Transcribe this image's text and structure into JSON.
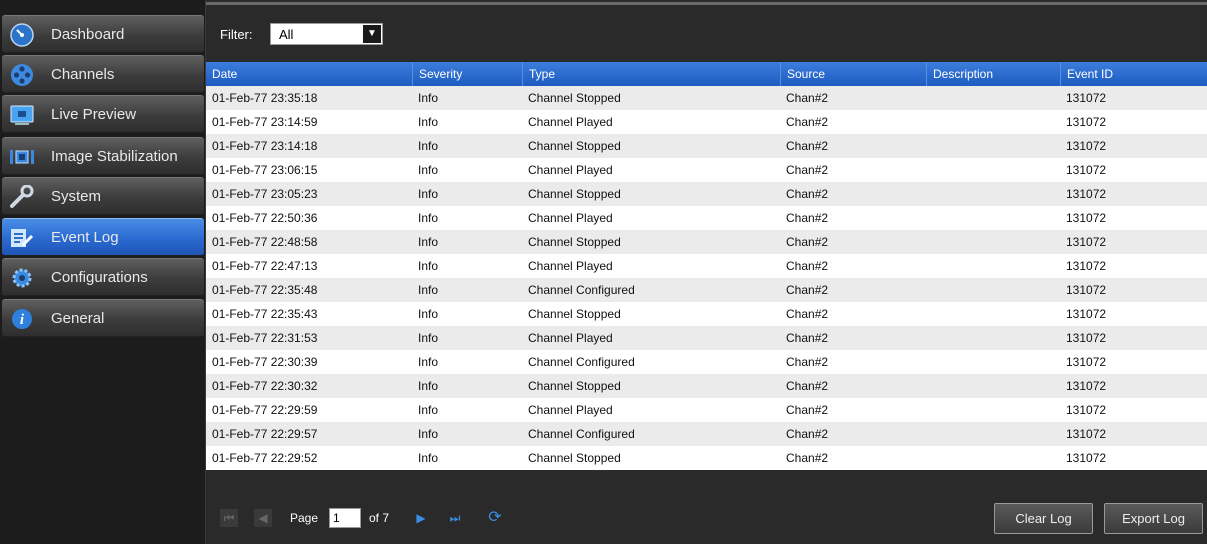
{
  "sidebar": {
    "items": [
      {
        "label": "Dashboard",
        "icon": "dashboard-gauge-icon"
      },
      {
        "label": "Channels",
        "icon": "film-reel-icon"
      },
      {
        "label": "Live Preview",
        "icon": "monitor-icon"
      },
      {
        "label": "Image Stabilization",
        "icon": "stabilization-icon"
      },
      {
        "label": "System",
        "icon": "wrench-icon"
      },
      {
        "label": "Event Log",
        "icon": "edit-log-icon"
      },
      {
        "label": "Configurations",
        "icon": "gear-icon"
      },
      {
        "label": "General",
        "icon": "info-icon"
      }
    ],
    "active": "Event Log"
  },
  "filter": {
    "label": "Filter:",
    "value": "All"
  },
  "table": {
    "columns": [
      "Date",
      "Severity",
      "Type",
      "Source",
      "Description",
      "Event ID"
    ],
    "rows": [
      [
        "01-Feb-77 23:35:18",
        "Info",
        "Channel Stopped",
        "Chan#2",
        "",
        "131072"
      ],
      [
        "01-Feb-77 23:14:59",
        "Info",
        "Channel Played",
        "Chan#2",
        "",
        "131072"
      ],
      [
        "01-Feb-77 23:14:18",
        "Info",
        "Channel Stopped",
        "Chan#2",
        "",
        "131072"
      ],
      [
        "01-Feb-77 23:06:15",
        "Info",
        "Channel Played",
        "Chan#2",
        "",
        "131072"
      ],
      [
        "01-Feb-77 23:05:23",
        "Info",
        "Channel Stopped",
        "Chan#2",
        "",
        "131072"
      ],
      [
        "01-Feb-77 22:50:36",
        "Info",
        "Channel Played",
        "Chan#2",
        "",
        "131072"
      ],
      [
        "01-Feb-77 22:48:58",
        "Info",
        "Channel Stopped",
        "Chan#2",
        "",
        "131072"
      ],
      [
        "01-Feb-77 22:47:13",
        "Info",
        "Channel Played",
        "Chan#2",
        "",
        "131072"
      ],
      [
        "01-Feb-77 22:35:48",
        "Info",
        "Channel Configured",
        "Chan#2",
        "",
        "131072"
      ],
      [
        "01-Feb-77 22:35:43",
        "Info",
        "Channel Stopped",
        "Chan#2",
        "",
        "131072"
      ],
      [
        "01-Feb-77 22:31:53",
        "Info",
        "Channel Played",
        "Chan#2",
        "",
        "131072"
      ],
      [
        "01-Feb-77 22:30:39",
        "Info",
        "Channel Configured",
        "Chan#2",
        "",
        "131072"
      ],
      [
        "01-Feb-77 22:30:32",
        "Info",
        "Channel Stopped",
        "Chan#2",
        "",
        "131072"
      ],
      [
        "01-Feb-77 22:29:59",
        "Info",
        "Channel Played",
        "Chan#2",
        "",
        "131072"
      ],
      [
        "01-Feb-77 22:29:57",
        "Info",
        "Channel Configured",
        "Chan#2",
        "",
        "131072"
      ],
      [
        "01-Feb-77 22:29:52",
        "Info",
        "Channel Stopped",
        "Chan#2",
        "",
        "131072"
      ]
    ]
  },
  "pager": {
    "page_label": "Page",
    "page_value": "1",
    "of_text": "of 7"
  },
  "actions": {
    "clear_label": "Clear Log",
    "export_label": "Export Log"
  },
  "colors": {
    "accent": "#2b6ad1",
    "header": "#1e5cc0",
    "background": "#2a2a2a"
  }
}
